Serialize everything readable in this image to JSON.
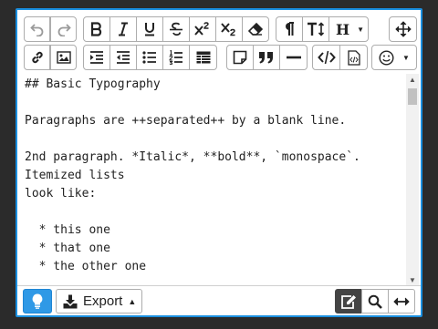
{
  "toolbar": {
    "heading_label": "H",
    "row1": [
      "undo-icon",
      "redo-icon",
      "bold-icon",
      "italic-icon",
      "underline-icon",
      "strikethrough-icon",
      "superscript-icon",
      "subscript-icon",
      "eraser-icon",
      "paragraph-icon",
      "text-height-icon",
      "heading-icon",
      "move-icon"
    ],
    "row2": [
      "link-icon",
      "image-icon",
      "indent-icon",
      "outdent-icon",
      "bullet-list-icon",
      "numbered-list-icon",
      "table-icon",
      "sticky-note-icon",
      "quote-icon",
      "horizontal-rule-icon",
      "code-icon",
      "code-file-icon",
      "emoji-icon"
    ]
  },
  "content": {
    "lines": [
      "## Basic Typography",
      "",
      "Paragraphs are ++separated++ by a blank line.",
      "",
      "2nd paragraph. *Italic*, **bold**, `monospace`.",
      "Itemized lists",
      "look like:",
      "",
      "  * this one",
      "  * that one",
      "  * the other one"
    ]
  },
  "statusbar": {
    "export_label": "Export"
  },
  "colors": {
    "border_accent": "#1a8fe0",
    "lamp_button": "#2f99e6",
    "active_edit": "#444444"
  }
}
